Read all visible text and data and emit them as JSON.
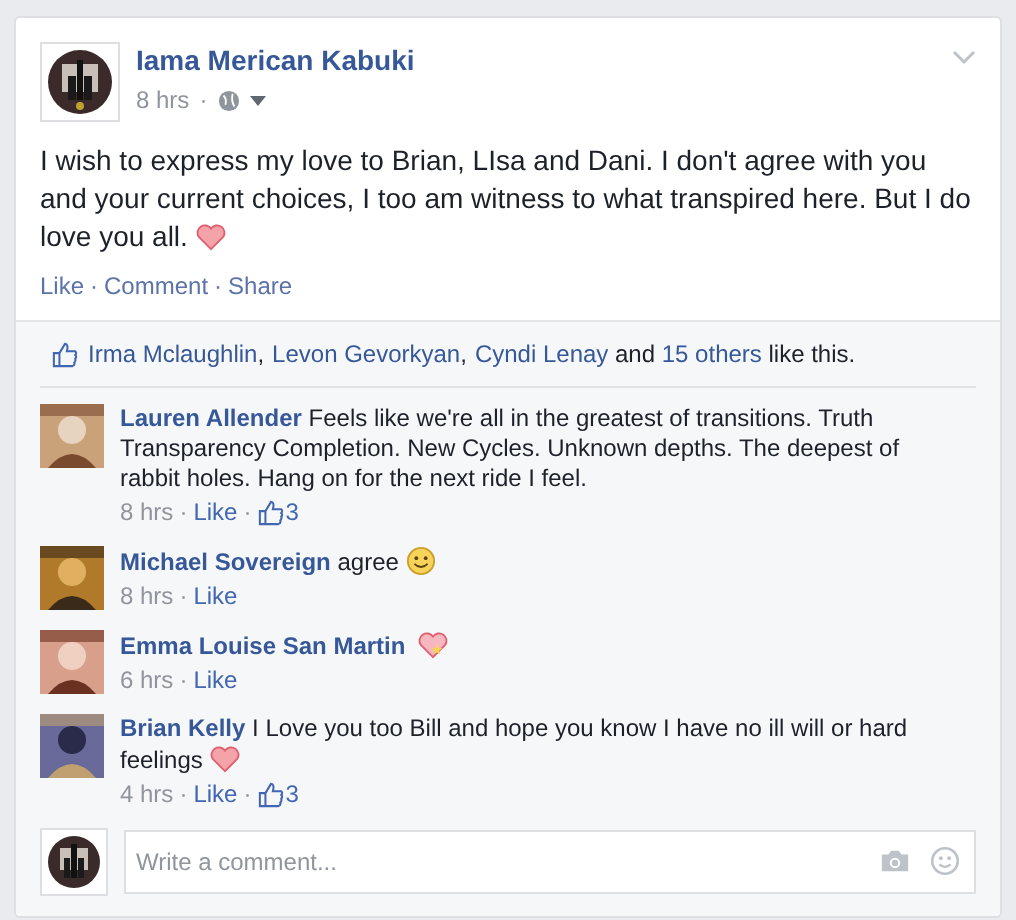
{
  "post": {
    "author": "Iama Merican Kabuki",
    "time": "8 hrs",
    "separator": "·",
    "text": "I wish to express my love to Brian, LIsa and Dani. I don't agree with you and your current choices, I too am witness to what transpired here. But I do love you all.",
    "kind": "heart",
    "actions": [
      "Like",
      "Comment",
      "Share"
    ]
  },
  "likes": {
    "names": [
      "Irma Mclaughlin",
      "Levon Gevorkyan",
      "Cyndi Lenay"
    ],
    "separator": ",",
    "joiner": "and",
    "others": "15 others",
    "suffix": "like this."
  },
  "comments": [
    {
      "kind": "plain",
      "author": "Lauren Allender",
      "text": "Feels like we're all in the greatest of transitions. Truth Transparency Completion. New Cycles. Unknown depths. The deepest of rabbit holes. Hang on for the next ride I feel.",
      "time": "8 hrs",
      "like": "Like",
      "like_count": "3"
    },
    {
      "kind": "smile",
      "author": "Michael Sovereign",
      "text": "agree",
      "time": "8 hrs",
      "like": "Like"
    },
    {
      "kind": "sparkle_heart",
      "author": "Emma Louise San Martin",
      "time": "6 hrs",
      "like": "Like"
    },
    {
      "kind": "heart",
      "author": "Brian Kelly",
      "text": "I Love you too Bill and hope you know I have no ill will or hard feelings",
      "time": "4 hrs",
      "like": "Like",
      "like_count": "3"
    }
  ],
  "composer": {
    "placeholder": "Write a comment..."
  }
}
